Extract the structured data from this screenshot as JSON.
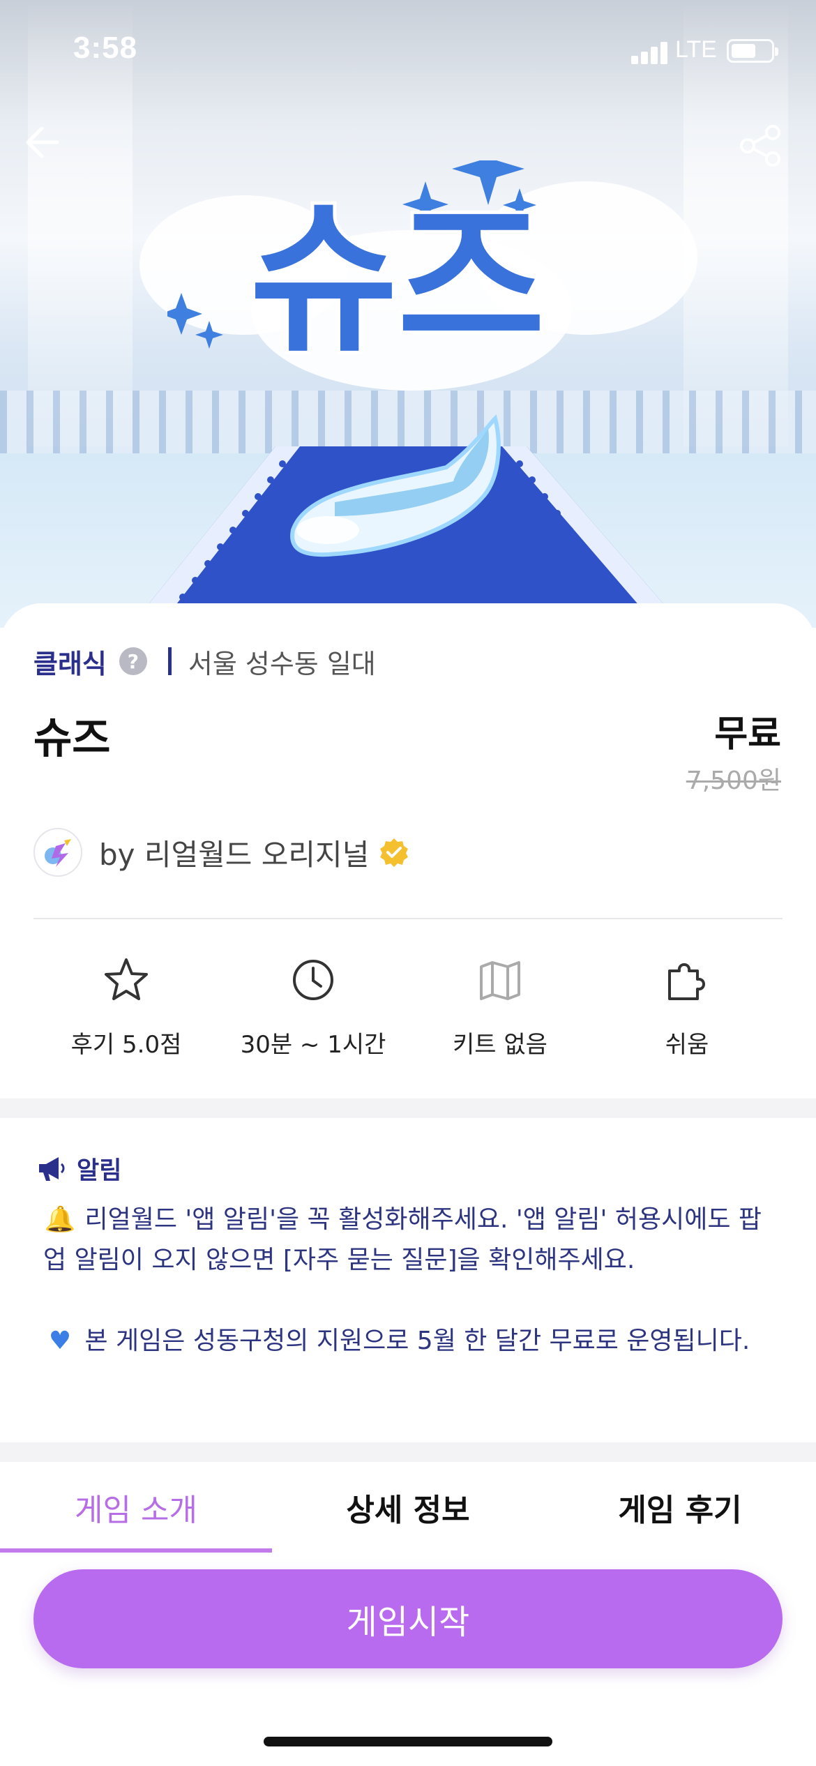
{
  "status_bar": {
    "time": "3:58",
    "network": "LTE"
  },
  "hero": {
    "logo_text": "슈즈"
  },
  "header": {
    "category": "클래식",
    "region": "서울 성수동 일대"
  },
  "game": {
    "title": "슈즈",
    "price": "무료",
    "original_price": "7,500원"
  },
  "author": {
    "name": "by 리얼월드 오리지널"
  },
  "stats": [
    {
      "icon": "star-icon",
      "label": "후기 5.0점"
    },
    {
      "icon": "clock-icon",
      "label": "30분 ~ 1시간"
    },
    {
      "icon": "map-icon",
      "label": "키트 없음"
    },
    {
      "icon": "puzzle-icon",
      "label": "쉬움"
    }
  ],
  "notice": {
    "title": "알림",
    "line1": "리얼월드 '앱 알림'을 꼭 활성화해주세요. '앱 알림' 허용시에도 팝업 알림이 오지 않으면 [자주 묻는 질문]을 확인해주세요.",
    "line2": "본 게임은 성동구청의 지원으로 5월 한 달간 무료로 운영됩니다."
  },
  "tabs": [
    {
      "label": "게임 소개",
      "active": true
    },
    {
      "label": "상세 정보",
      "active": false
    },
    {
      "label": "게임 후기",
      "active": false
    }
  ],
  "cta": {
    "label": "게임시작"
  },
  "colors": {
    "accent": "#b96bf0",
    "navy": "#2b2f8c",
    "badge": "#f4c030"
  }
}
